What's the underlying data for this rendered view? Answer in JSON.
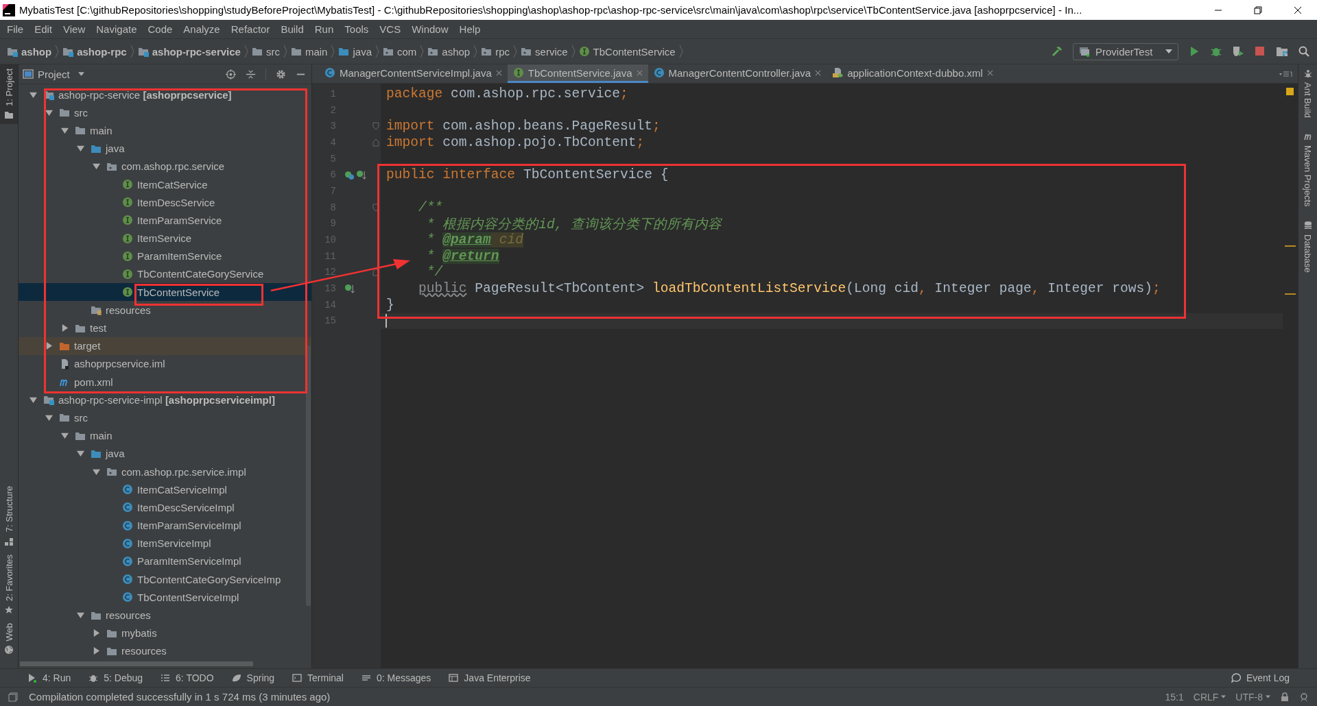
{
  "window": {
    "title": "MybatisTest [C:\\githubRepositories\\shopping\\studyBeforeProject\\MybatisTest] - C:\\githubRepositories\\shopping\\ashop\\ashop-rpc\\ashop-rpc-service\\src\\main\\java\\com\\ashop\\rpc\\service\\TbContentService.java [ashoprpcservice] - In..."
  },
  "menu": [
    "File",
    "Edit",
    "View",
    "Navigate",
    "Code",
    "Analyze",
    "Refactor",
    "Build",
    "Run",
    "Tools",
    "VCS",
    "Window",
    "Help"
  ],
  "breadcrumbs": [
    {
      "label": "ashop",
      "kind": "module"
    },
    {
      "label": "ashop-rpc",
      "kind": "module"
    },
    {
      "label": "ashop-rpc-service",
      "kind": "module"
    },
    {
      "label": "src",
      "kind": "folder"
    },
    {
      "label": "main",
      "kind": "folder"
    },
    {
      "label": "java",
      "kind": "source-folder"
    },
    {
      "label": "com",
      "kind": "package"
    },
    {
      "label": "ashop",
      "kind": "package"
    },
    {
      "label": "rpc",
      "kind": "package"
    },
    {
      "label": "service",
      "kind": "package"
    },
    {
      "label": "TbContentService",
      "kind": "interface"
    }
  ],
  "run_config": {
    "label": "ProviderTest"
  },
  "left_strip": [
    {
      "label": "1: Project",
      "kind": "project",
      "selected": true
    },
    {
      "label": "7: Structure",
      "kind": "structure",
      "selected": false
    },
    {
      "label": "2: Favorites",
      "kind": "favorites",
      "selected": false
    },
    {
      "label": "Web",
      "kind": "web",
      "selected": false
    }
  ],
  "right_strip": [
    {
      "label": "Ant Build",
      "kind": "ant"
    },
    {
      "label": "Maven Projects",
      "kind": "maven"
    },
    {
      "label": "Database",
      "kind": "database"
    }
  ],
  "project_panel": {
    "title": "Project",
    "tree": [
      {
        "label": "ashop-rpc-service **[ashoprpcservice]**",
        "kind": "module",
        "expanded": true,
        "selected": false,
        "children": [
          {
            "label": "src",
            "kind": "folder",
            "expanded": true,
            "selected": false,
            "children": [
              {
                "label": "main",
                "kind": "folder",
                "expanded": true,
                "selected": false,
                "children": [
                  {
                    "label": "java",
                    "kind": "source-folder",
                    "expanded": true,
                    "selected": false,
                    "children": [
                      {
                        "label": "com.ashop.rpc.service",
                        "kind": "package",
                        "expanded": true,
                        "selected": false,
                        "children": [
                          {
                            "label": "ItemCatService",
                            "kind": "interface",
                            "selected": false
                          },
                          {
                            "label": "ItemDescService",
                            "kind": "interface",
                            "selected": false
                          },
                          {
                            "label": "ItemParamService",
                            "kind": "interface",
                            "selected": false
                          },
                          {
                            "label": "ItemService",
                            "kind": "interface",
                            "selected": false
                          },
                          {
                            "label": "ParamItemService",
                            "kind": "interface",
                            "selected": false
                          },
                          {
                            "label": "TbContentCateGoryService",
                            "kind": "interface",
                            "selected": false
                          },
                          {
                            "label": "TbContentService",
                            "kind": "interface",
                            "selected": true
                          }
                        ]
                      }
                    ]
                  },
                  {
                    "label": "resources",
                    "kind": "resources-folder",
                    "selected": false
                  }
                ]
              },
              {
                "label": "test",
                "kind": "folder",
                "expanded": false,
                "selected": false
              }
            ]
          },
          {
            "label": "target",
            "kind": "excluded-folder",
            "expanded": false,
            "selected": false
          },
          {
            "label": "ashoprpcservice.iml",
            "kind": "iml-file",
            "selected": false
          },
          {
            "label": "pom.xml",
            "kind": "maven-file",
            "selected": false
          }
        ]
      },
      {
        "label": "ashop-rpc-service-impl **[ashoprpcserviceimpl]**",
        "kind": "module",
        "expanded": true,
        "selected": false,
        "children": [
          {
            "label": "src",
            "kind": "folder",
            "expanded": true,
            "selected": false,
            "children": [
              {
                "label": "main",
                "kind": "folder",
                "expanded": true,
                "selected": false,
                "children": [
                  {
                    "label": "java",
                    "kind": "source-folder",
                    "expanded": true,
                    "selected": false,
                    "children": [
                      {
                        "label": "com.ashop.rpc.service.impl",
                        "kind": "package",
                        "expanded": true,
                        "selected": false,
                        "children": [
                          {
                            "label": "ItemCatServiceImpl",
                            "kind": "class",
                            "selected": false
                          },
                          {
                            "label": "ItemDescServiceImpl",
                            "kind": "class",
                            "selected": false
                          },
                          {
                            "label": "ItemParamServiceImpl",
                            "kind": "class",
                            "selected": false
                          },
                          {
                            "label": "ItemServiceImpl",
                            "kind": "class",
                            "selected": false
                          },
                          {
                            "label": "ParamItemServiceImpl",
                            "kind": "class",
                            "selected": false
                          },
                          {
                            "label": "TbContentCateGoryServiceImp",
                            "kind": "class",
                            "selected": false
                          },
                          {
                            "label": "TbContentServiceImpl",
                            "kind": "class",
                            "selected": false
                          }
                        ]
                      }
                    ]
                  },
                  {
                    "label": "resources",
                    "kind": "folder",
                    "expanded": true,
                    "selected": false,
                    "children": [
                      {
                        "label": "mybatis",
                        "kind": "folder",
                        "expanded": false,
                        "selected": false
                      },
                      {
                        "label": "resources",
                        "kind": "folder",
                        "expanded": false,
                        "selected": false
                      }
                    ]
                  }
                ]
              }
            ]
          }
        ]
      }
    ]
  },
  "tabs": [
    {
      "label": "ManagerContentServiceImpl.java",
      "kind": "class",
      "selected": false
    },
    {
      "label": "TbContentService.java",
      "kind": "interface",
      "selected": true
    },
    {
      "label": "ManagerContentController.java",
      "kind": "class",
      "selected": false
    },
    {
      "label": "applicationContext-dubbo.xml",
      "kind": "xml",
      "selected": false
    }
  ],
  "editor": {
    "lines": [
      {
        "number": "1",
        "tokens": [
          {
            "kind": "keyword",
            "text": "package"
          },
          {
            "kind": "plain",
            "text": " com.ashop.rpc.service"
          },
          {
            "kind": "keyword",
            "text": ";"
          }
        ],
        "current": false
      },
      {
        "number": "2",
        "current": false
      },
      {
        "number": "3",
        "tokens": [
          {
            "kind": "keyword",
            "text": "import"
          },
          {
            "kind": "plain",
            "text": " com.ashop.beans.PageResult"
          },
          {
            "kind": "keyword",
            "text": ";"
          }
        ],
        "fold": {
          "kind": "start"
        },
        "current": false
      },
      {
        "number": "4",
        "tokens": [
          {
            "kind": "keyword",
            "text": "import"
          },
          {
            "kind": "plain",
            "text": " com.ashop.pojo.TbContent"
          },
          {
            "kind": "keyword",
            "text": ";"
          }
        ],
        "fold": {
          "kind": "end"
        },
        "current": false
      },
      {
        "number": "5",
        "current": false
      },
      {
        "number": "6",
        "tokens": [
          {
            "kind": "keyword",
            "text": "public interface"
          },
          {
            "kind": "plain",
            "text": " TbContentService {"
          }
        ],
        "gutter": {
          "kind": "interface-implemented"
        },
        "current": false
      },
      {
        "number": "7",
        "current": false
      },
      {
        "number": "8",
        "tokens": [
          {
            "kind": "comment",
            "text": "    /**"
          }
        ],
        "fold": {
          "kind": "start"
        },
        "current": false
      },
      {
        "number": "9",
        "tokens": [
          {
            "kind": "comment",
            "text": "     * 根据内容分类的id, 查询该分类下的所有内容"
          }
        ],
        "current": false
      },
      {
        "number": "10",
        "tokens": [
          {
            "kind": "comment",
            "text": "     * "
          },
          {
            "kind": "doctag",
            "text": "@param"
          },
          {
            "kind": "paramref",
            "text": " cid"
          }
        ],
        "current": false
      },
      {
        "number": "11",
        "tokens": [
          {
            "kind": "comment",
            "text": "     * "
          },
          {
            "kind": "doctag",
            "text": "@return"
          }
        ],
        "current": false
      },
      {
        "number": "12",
        "tokens": [
          {
            "kind": "comment",
            "text": "     */"
          }
        ],
        "fold": {
          "kind": "end"
        },
        "current": false
      },
      {
        "number": "13",
        "tokens": [
          {
            "kind": "unused",
            "text": "public"
          },
          {
            "kind": "plain",
            "text": " PageResult<TbContent> "
          },
          {
            "kind": "method",
            "text": "loadTbContentListService"
          },
          {
            "kind": "plain",
            "text": "(Long cid"
          },
          {
            "kind": "keyword",
            "text": ","
          },
          {
            "kind": "plain",
            "text": " Integer page"
          },
          {
            "kind": "keyword",
            "text": ","
          },
          {
            "kind": "plain",
            "text": " Integer rows)"
          },
          {
            "kind": "keyword",
            "text": ";"
          }
        ],
        "gutter": {
          "kind": "method-implemented"
        },
        "current": false
      },
      {
        "number": "14",
        "tokens": [
          {
            "kind": "plain",
            "text": "}"
          }
        ],
        "current": false
      },
      {
        "number": "15",
        "current": true
      }
    ]
  },
  "bottom_tools": [
    {
      "label": "4: Run",
      "kind": "run"
    },
    {
      "label": "5: Debug",
      "kind": "debug"
    },
    {
      "label": "6: TODO",
      "kind": "todo"
    },
    {
      "label": "Spring",
      "kind": "spring"
    },
    {
      "label": "Terminal",
      "kind": "terminal"
    },
    {
      "label": "0: Messages",
      "kind": "messages"
    },
    {
      "label": "Java Enterprise",
      "kind": "javaee"
    }
  ],
  "event_log": "Event Log",
  "status_bar": {
    "message": "Compilation completed successfully in 1 s 724 ms (3 minutes ago)",
    "position": "15:1",
    "line_separator": "CRLF",
    "encoding": "UTF-8"
  }
}
